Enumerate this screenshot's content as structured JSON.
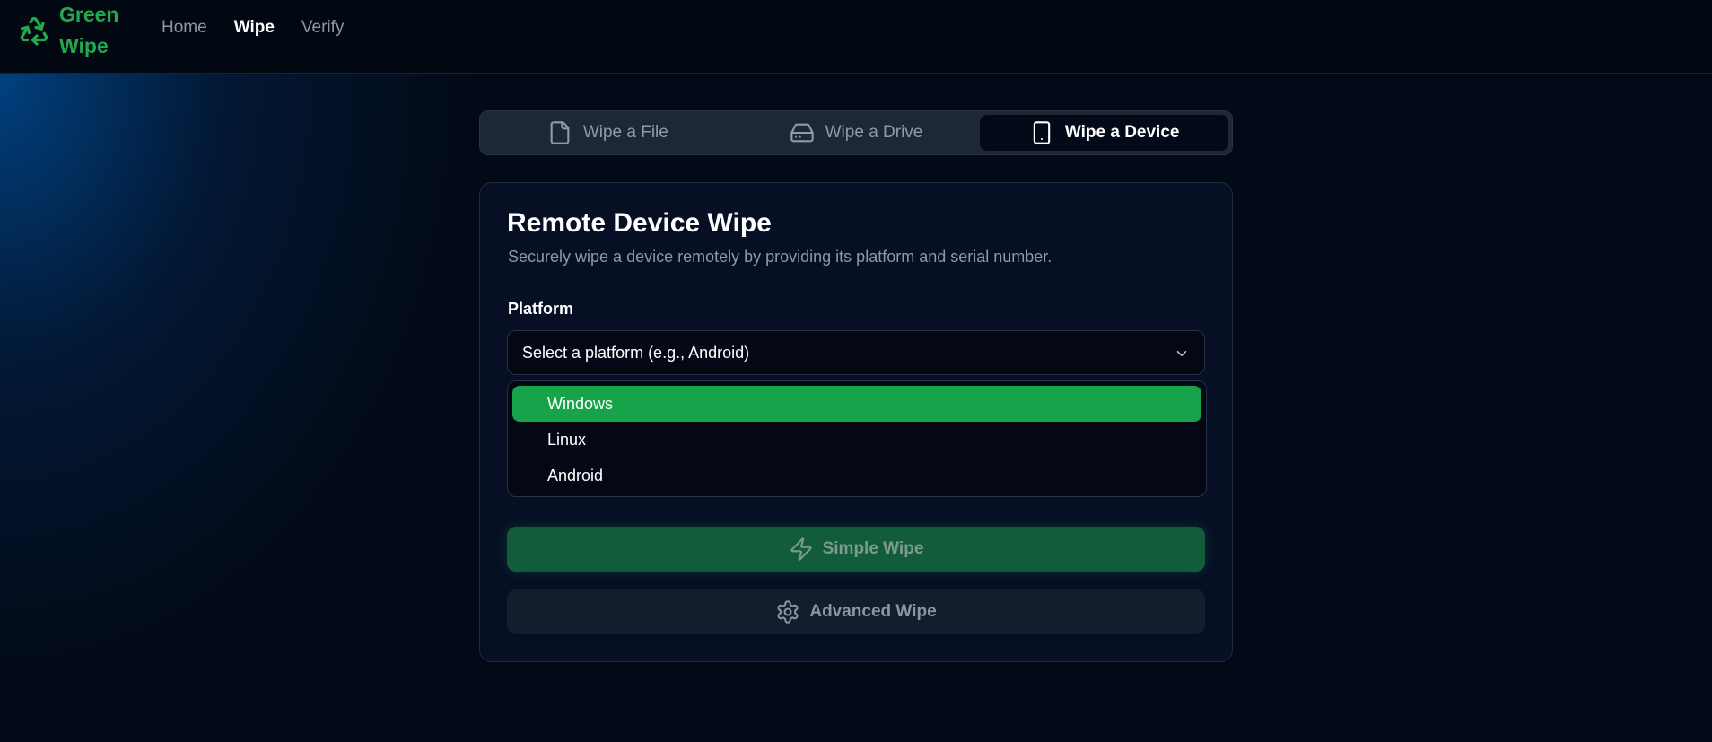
{
  "brand": {
    "name_line1": "Green",
    "name_line2": "Wipe",
    "logo_icon": "recycle-icon",
    "color": "#22a94e"
  },
  "nav": {
    "items": [
      {
        "label": "Home",
        "active": false
      },
      {
        "label": "Wipe",
        "active": true
      },
      {
        "label": "Verify",
        "active": false
      }
    ]
  },
  "tabs": [
    {
      "label": "Wipe a File",
      "icon": "file-icon",
      "active": false
    },
    {
      "label": "Wipe a Drive",
      "icon": "hard-drive-icon",
      "active": false
    },
    {
      "label": "Wipe a Device",
      "icon": "smartphone-icon",
      "active": true
    }
  ],
  "card": {
    "title": "Remote Device Wipe",
    "subtitle": "Securely wipe a device remotely by providing its platform and serial number.",
    "platform_label": "Platform",
    "platform_placeholder": "Select a platform (e.g., Android)",
    "platform_options": [
      {
        "label": "Windows",
        "highlighted": true
      },
      {
        "label": "Linux",
        "highlighted": false
      },
      {
        "label": "Android",
        "highlighted": false
      }
    ],
    "simple_wipe_label": "Simple Wipe",
    "simple_wipe_icon": "zap-icon",
    "advanced_wipe_label": "Advanced Wipe",
    "advanced_wipe_icon": "gear-icon"
  },
  "colors": {
    "accent": "#16a34a",
    "background": "#030a17"
  }
}
